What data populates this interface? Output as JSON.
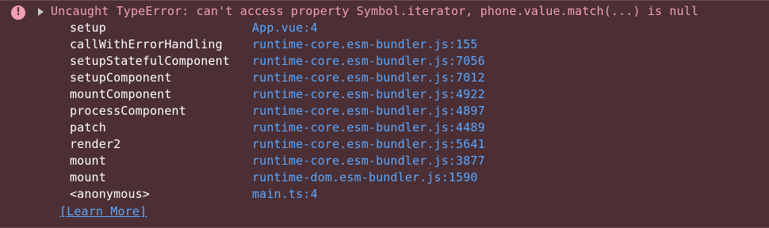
{
  "console": {
    "error_message": "Uncaught TypeError: can't access property Symbol.iterator, phone.value.match(...) is null",
    "learn_more": "[Learn More]",
    "icon": "error-icon",
    "stack": [
      {
        "function": "setup",
        "location": "App.vue:4"
      },
      {
        "function": "callWithErrorHandling",
        "location": "runtime-core.esm-bundler.js:155"
      },
      {
        "function": "setupStatefulComponent",
        "location": "runtime-core.esm-bundler.js:7056"
      },
      {
        "function": "setupComponent",
        "location": "runtime-core.esm-bundler.js:7012"
      },
      {
        "function": "mountComponent",
        "location": "runtime-core.esm-bundler.js:4922"
      },
      {
        "function": "processComponent",
        "location": "runtime-core.esm-bundler.js:4897"
      },
      {
        "function": "patch",
        "location": "runtime-core.esm-bundler.js:4489"
      },
      {
        "function": "render2",
        "location": "runtime-core.esm-bundler.js:5641"
      },
      {
        "function": "mount",
        "location": "runtime-core.esm-bundler.js:3877"
      },
      {
        "function": "mount",
        "location": "runtime-dom.esm-bundler.js:1590"
      },
      {
        "function": "<anonymous>",
        "location": "main.ts:4"
      }
    ],
    "colors": {
      "background": "#4b2f35",
      "error_text": "#f3a0b2",
      "link": "#5aa7ff",
      "text": "#ffffff"
    }
  }
}
